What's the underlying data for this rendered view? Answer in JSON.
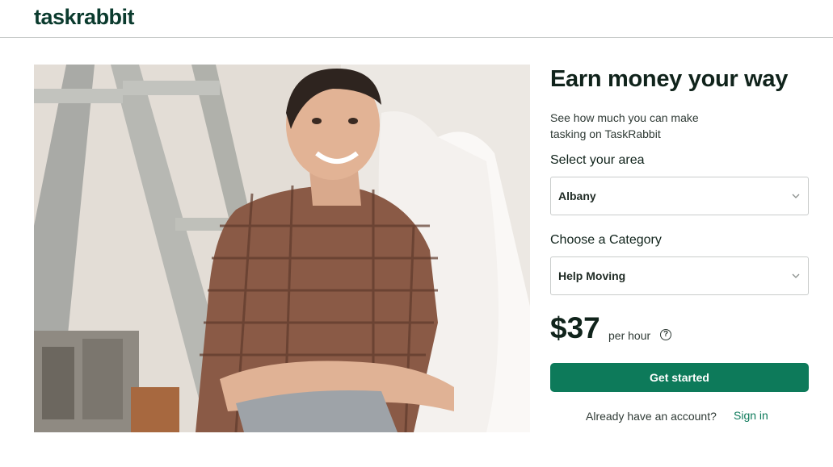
{
  "header": {
    "logo": "taskrabbit"
  },
  "hero": {
    "image_description_icon": "smiling-tasker-photo"
  },
  "panel": {
    "title": "Earn money your way",
    "subtitle": "See how much you can make tasking on TaskRabbit",
    "area_label": "Select your area",
    "area_value": "Albany",
    "category_label": "Choose a Category",
    "category_value": "Help Moving",
    "price": "$37",
    "per_hour": "per hour",
    "help_glyph": "?",
    "cta_label": "Get started",
    "account_text": "Already have an account?",
    "signin_label": "Sign in"
  },
  "colors": {
    "brand_green": "#0d7a5a",
    "logo_green": "#0b3b2e"
  }
}
